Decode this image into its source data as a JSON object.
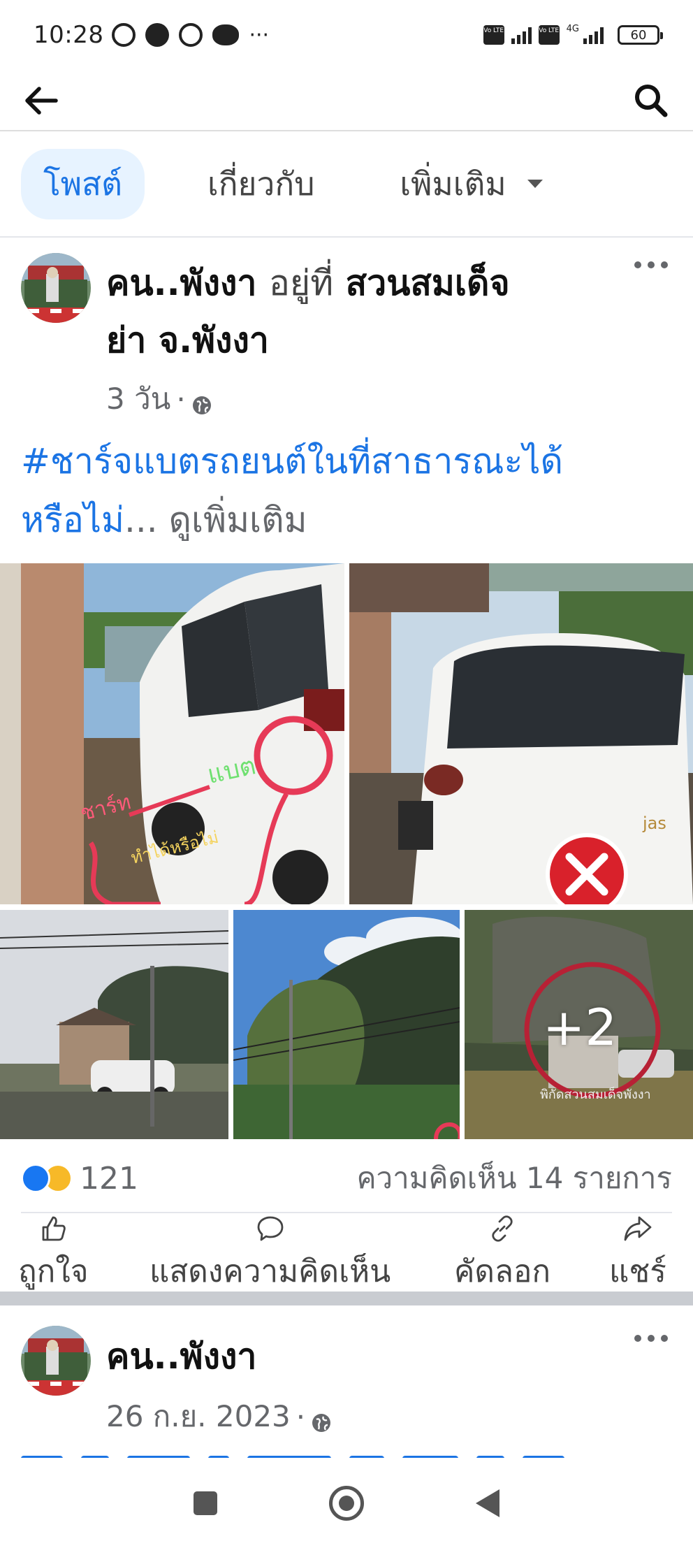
{
  "status_bar": {
    "time": "10:28",
    "battery": "60",
    "network": "4G",
    "volte_label": "Vo LTE"
  },
  "tabs": {
    "posts": "โพสต์",
    "about": "เกี่ยวกับ",
    "more": "เพิ่มเติม"
  },
  "post1": {
    "author": "คน..พังงา",
    "at_word": "อยู่ที่",
    "place_line1": "สวนสมเด็จ",
    "place_line2": "ย่า  จ.พังงา",
    "time": "3 วัน",
    "meta_sep": "·",
    "text_line1": "#ชาร์จแบตรถยนต์ในที่สาธารณะได้",
    "text_line2": "หรือไม่",
    "ellipsis": "...",
    "see_more": "ดูเพิ่มเติม",
    "photo1_label_charge": "ชาร์ท",
    "photo1_label_battery": "แบต",
    "photo1_label_question": "ทำได้หรือไม่",
    "photo5_watermark": "พิกัดสวนสมเด็จพังงา",
    "extra_photos": "+2",
    "reaction_count": "121",
    "comments": "ความคิดเห็น 14 รายการ"
  },
  "actions": {
    "like": "ถูกใจ",
    "comment": "แสดงความคิดเห็น",
    "copy": "คัดลอก",
    "share": "แชร์"
  },
  "post2": {
    "author": "คน..พังงา",
    "date": "26 ก.ย. 2023",
    "meta_sep": "·"
  },
  "colors": {
    "accent": "#1b74e4",
    "like_blue": "#1877f2",
    "haha_yellow": "#f7b928",
    "muted": "#65676b"
  },
  "icons": [
    "alarm-icon",
    "messenger-icon",
    "alarm-icon",
    "line-icon",
    "more-icon",
    "back-arrow-icon",
    "search-icon",
    "globe-icon",
    "more-dots-icon",
    "like-icon",
    "comment-icon",
    "link-icon",
    "share-icon"
  ]
}
